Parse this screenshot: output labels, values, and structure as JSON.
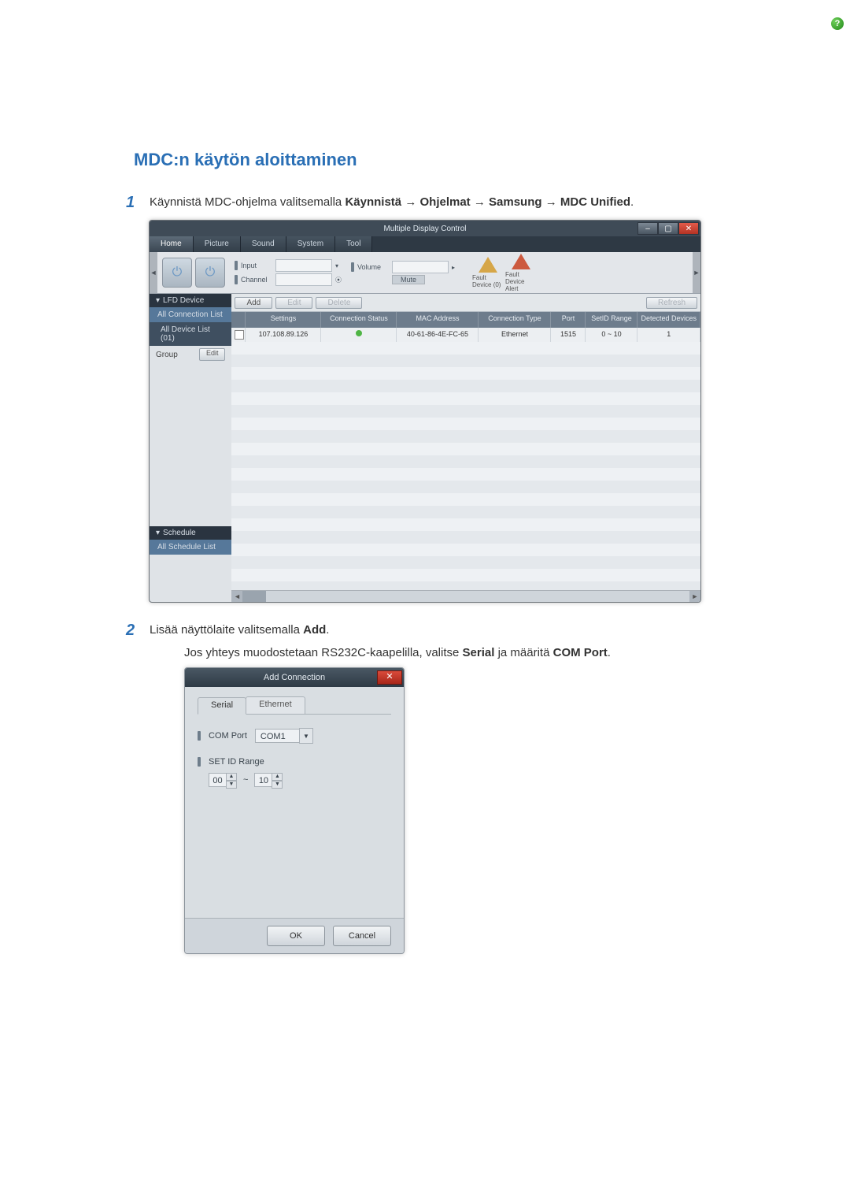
{
  "heading": "MDC:n käytön aloittaminen",
  "step1": {
    "num": "1",
    "prefix": "Käynnistä MDC-ohjelma valitsemalla ",
    "k1": "Käynnistä",
    "arrow": " → ",
    "k2": "Ohjelmat",
    "k3": "Samsung",
    "k4": "MDC Unified",
    "suffix": "."
  },
  "step2": {
    "num": "2",
    "prefix": "Lisää näyttölaite valitsemalla ",
    "bold": "Add",
    "suffix": "."
  },
  "step2_sub": {
    "prefix": "Jos yhteys muodostetaan RS232C-kaapelilla, valitse ",
    "b1": "Serial",
    "mid": " ja määritä ",
    "b2": "COM Port",
    "suffix": "."
  },
  "mdc": {
    "title": "Multiple Display Control",
    "menus": {
      "home": "Home",
      "picture": "Picture",
      "sound": "Sound",
      "system": "System",
      "tool": "Tool"
    },
    "toolbar": {
      "input": "Input",
      "channel": "Channel",
      "volume": "Volume",
      "mute": "Mute",
      "fault1": "Fault Device (0)",
      "fault2": "Fault Device Alert"
    },
    "actions": {
      "add": "Add",
      "edit": "Edit",
      "delete": "Delete",
      "refresh": "Refresh"
    },
    "side": {
      "lfd": "LFD Device",
      "allconn": "All Connection List",
      "alldev": "All Device List (01)",
      "group": "Group",
      "editbtn": "Edit",
      "schedule": "Schedule",
      "allsched": "All Schedule List"
    },
    "cols": {
      "settings": "Settings",
      "connstat": "Connection Status",
      "mac": "MAC Address",
      "conntype": "Connection Type",
      "port": "Port",
      "setid": "SetID Range",
      "det": "Detected Devices"
    },
    "row": {
      "settings": "107.108.89.126",
      "mac": "40-61-86-4E-FC-65",
      "conntype": "Ethernet",
      "port": "1515",
      "setid": "0 ~ 10",
      "det": "1"
    }
  },
  "dlg": {
    "title": "Add Connection",
    "tab_serial": "Serial",
    "tab_ethernet": "Ethernet",
    "comport_lbl": "COM Port",
    "comport_val": "COM1",
    "setid_lbl": "SET ID Range",
    "spin_from": "00",
    "tilde": "~",
    "spin_to": "10",
    "ok": "OK",
    "cancel": "Cancel"
  }
}
